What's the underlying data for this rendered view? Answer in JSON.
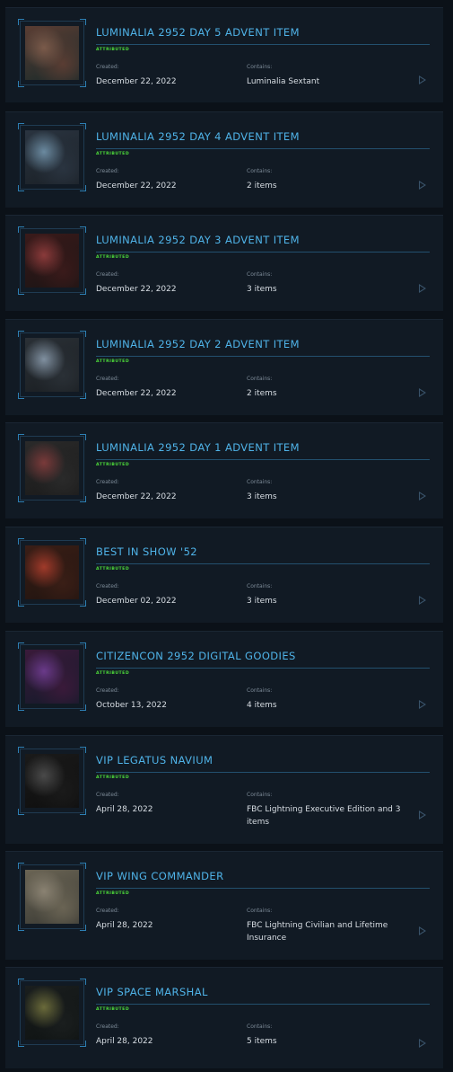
{
  "items": [
    {
      "title": "LUMINALIA 2952 DAY 5 ADVENT ITEM",
      "badge": "ATTRIBUTED",
      "created_label": "Created:",
      "created": "December 22, 2022",
      "contains_label": "Contains:",
      "contains": "Luminalia Sextant",
      "thumb_colors": [
        "#5a3d33",
        "#1a2a2a",
        "#7a5a4a"
      ]
    },
    {
      "title": "LUMINALIA 2952 DAY 4 ADVENT ITEM",
      "badge": "ATTRIBUTED",
      "created_label": "Created:",
      "created": "December 22, 2022",
      "contains_label": "Contains:",
      "contains": "2 items",
      "thumb_colors": [
        "#2a3440",
        "#1a2026",
        "#6b8aa0"
      ]
    },
    {
      "title": "LUMINALIA 2952 DAY 3 ADVENT ITEM",
      "badge": "ATTRIBUTED",
      "created_label": "Created:",
      "created": "December 22, 2022",
      "contains_label": "Contains:",
      "contains": "3 items",
      "thumb_colors": [
        "#3a1a1a",
        "#1a1414",
        "#8a3a3a"
      ]
    },
    {
      "title": "LUMINALIA 2952 DAY 2 ADVENT ITEM",
      "badge": "ATTRIBUTED",
      "created_label": "Created:",
      "created": "December 22, 2022",
      "contains_label": "Contains:",
      "contains": "2 items",
      "thumb_colors": [
        "#2a3036",
        "#1a1e22",
        "#8090a0"
      ]
    },
    {
      "title": "LUMINALIA 2952 DAY 1 ADVENT ITEM",
      "badge": "ATTRIBUTED",
      "created_label": "Created:",
      "created": "December 22, 2022",
      "contains_label": "Contains:",
      "contains": "3 items",
      "thumb_colors": [
        "#2a2a2a",
        "#1a1a1a",
        "#7a3a3a"
      ]
    },
    {
      "title": "BEST IN SHOW '52",
      "badge": "ATTRIBUTED",
      "created_label": "Created:",
      "created": "December 02, 2022",
      "contains_label": "Contains:",
      "contains": "3 items",
      "thumb_colors": [
        "#3a1e16",
        "#201410",
        "#a03a2a"
      ]
    },
    {
      "title": "CITIZENCON 2952 DIGITAL GOODIES",
      "badge": "ATTRIBUTED",
      "created_label": "Created:",
      "created": "October 13, 2022",
      "contains_label": "Contains:",
      "contains": "4 items",
      "thumb_colors": [
        "#3a1a3a",
        "#141a2a",
        "#6a3a8a"
      ]
    },
    {
      "title": "VIP LEGATUS NAVIUM",
      "badge": "ATTRIBUTED",
      "created_label": "Created:",
      "created": "April 28, 2022",
      "contains_label": "Contains:",
      "contains": "FBC Lightning Executive Edition and 3 items",
      "thumb_colors": [
        "#1a1a1a",
        "#0e0e0e",
        "#4a4a4a"
      ]
    },
    {
      "title": "VIP WING COMMANDER",
      "badge": "ATTRIBUTED",
      "created_label": "Created:",
      "created": "April 28, 2022",
      "contains_label": "Contains:",
      "contains": "FBC Lightning Civilian and Lifetime Insurance",
      "thumb_colors": [
        "#6a6454",
        "#3a3a34",
        "#8a8272"
      ]
    },
    {
      "title": "VIP SPACE MARSHAL",
      "badge": "ATTRIBUTED",
      "created_label": "Created:",
      "created": "April 28, 2022",
      "contains_label": "Contains:",
      "contains": "5 items",
      "thumb_colors": [
        "#1a1e1e",
        "#0e1212",
        "#6a6a3a"
      ]
    }
  ]
}
